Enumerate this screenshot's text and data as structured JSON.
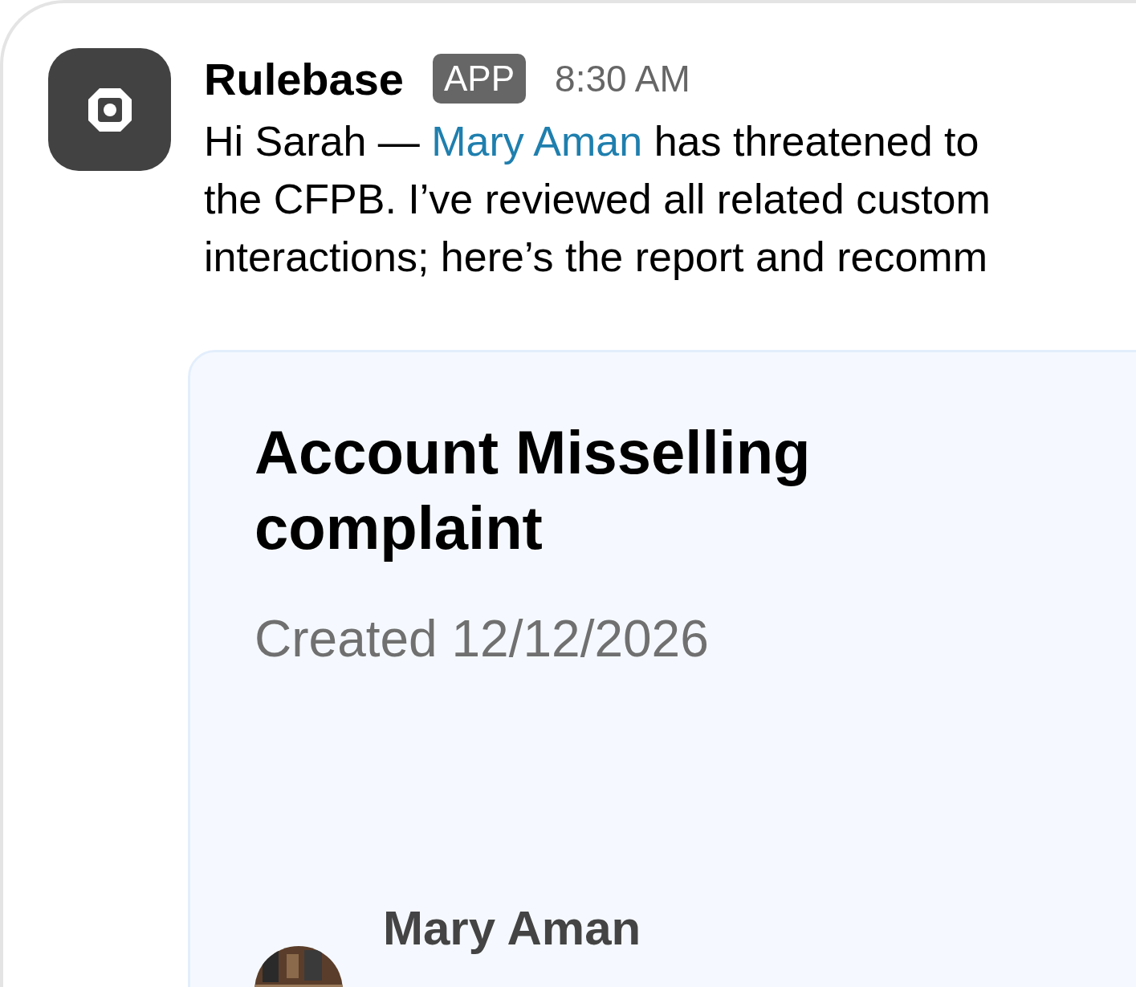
{
  "app": {
    "name": "Rulebase",
    "badge": "APP",
    "time": "8:30 AM"
  },
  "message": {
    "lines": [
      [
        {
          "text": "Hi Sarah — ",
          "kind": "plain"
        },
        {
          "text": "Mary Aman",
          "kind": "mention"
        },
        {
          "text": " has threatened to",
          "kind": "plain"
        }
      ],
      [
        {
          "text": "the CFPB. I’ve reviewed all related custom",
          "kind": "plain"
        }
      ],
      [
        {
          "text": "interactions; here’s the report and recomm",
          "kind": "plain"
        }
      ]
    ]
  },
  "card": {
    "title": "Account Misselling complaint",
    "created": "Created 12/12/2026",
    "customer": {
      "name": "Mary Aman"
    }
  }
}
